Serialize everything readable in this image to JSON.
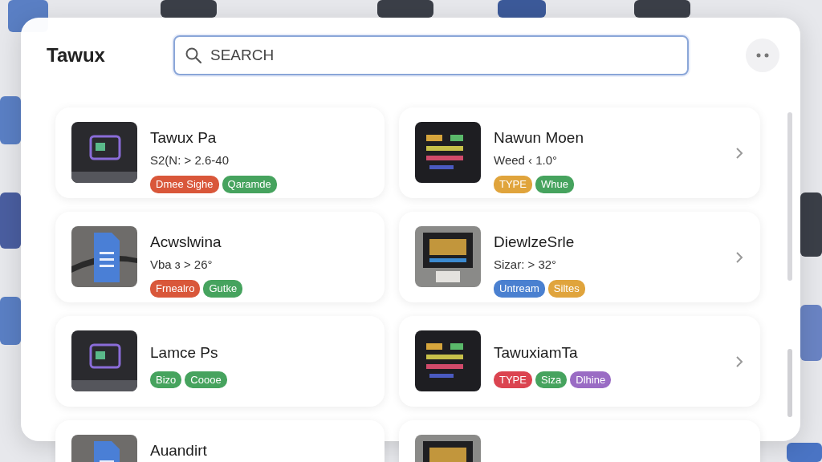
{
  "title": "Tawux",
  "search": {
    "placeholder": "SEARCH",
    "focused": true
  },
  "items": [
    {
      "title": "Tawux Pa",
      "subtitle": "S2(N: > 2.6-40",
      "chevron": false,
      "tags": [
        {
          "label": "Dmee Sighe",
          "color": "#d9573a"
        },
        {
          "label": "Qaramde",
          "color": "#46a35e"
        }
      ]
    },
    {
      "title": "Nawun Moen",
      "subtitle": "Weed ‹ 1.0°",
      "chevron": true,
      "tags": [
        {
          "label": "TYPE",
          "color": "#e0a43c"
        },
        {
          "label": "Whue",
          "color": "#46a35e"
        }
      ]
    },
    {
      "title": "Acwslwina",
      "subtitle": "Vba ɜ > 26°",
      "chevron": false,
      "tags": [
        {
          "label": "Frnealro",
          "color": "#d9573a"
        },
        {
          "label": "Gutke",
          "color": "#46a35e"
        }
      ]
    },
    {
      "title": "DiewlzeSrle",
      "subtitle": "Sizar: > 32°",
      "chevron": true,
      "tags": [
        {
          "label": "Untream",
          "color": "#4a80d0"
        },
        {
          "label": "Siltes",
          "color": "#e0a43c"
        }
      ]
    },
    {
      "title": "Lamce Ps",
      "chevron": false,
      "tags": [
        {
          "label": "Bizo",
          "color": "#46a35e"
        },
        {
          "label": "Coooe",
          "color": "#46a35e"
        }
      ]
    },
    {
      "title": "TawuxiamTa",
      "chevron": true,
      "tags": [
        {
          "label": "TYPE",
          "color": "#db4450"
        },
        {
          "label": "Siza",
          "color": "#46a35e"
        },
        {
          "label": "Dlhine",
          "color": "#9a6cc4"
        }
      ]
    },
    {
      "title": "Auandirt"
    },
    {
      "kind": "picture"
    }
  ]
}
